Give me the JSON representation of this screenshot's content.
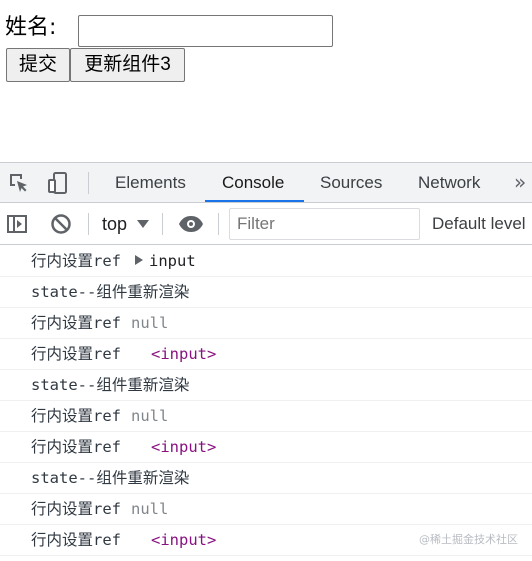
{
  "page": {
    "name_label": "姓名:",
    "name_value": "",
    "submit_label": "提交",
    "update_label": "更新组件3"
  },
  "devtools": {
    "tabs": [
      "Elements",
      "Console",
      "Sources",
      "Network"
    ],
    "more_label": "»",
    "context": "top",
    "filter_placeholder": "Filter",
    "levels_label": "Default level",
    "icons": [
      "inspect-element-icon",
      "device-toolbar-icon",
      "sidebar-toggle-icon",
      "clear-console-icon",
      "eye-icon",
      "dropdown-arrow-icon",
      "expand-arrow-icon"
    ],
    "colors": {
      "accent": "#1a73e8",
      "tag": "#881280",
      "null": "#80868b"
    }
  },
  "console": {
    "messages": [
      {
        "prefix": "行内设置ref",
        "object": "input"
      },
      {
        "prefix": "state--组件重新渲染"
      },
      {
        "prefix": "行内设置ref",
        "null": "null"
      },
      {
        "prefix": "行内设置ref",
        "tag": "<input>"
      },
      {
        "prefix": "state--组件重新渲染"
      },
      {
        "prefix": "行内设置ref",
        "null": "null"
      },
      {
        "prefix": "行内设置ref",
        "tag": "<input>"
      },
      {
        "prefix": "state--组件重新渲染"
      },
      {
        "prefix": "行内设置ref",
        "null": "null"
      },
      {
        "prefix": "行内设置ref",
        "tag": "<input>"
      }
    ]
  },
  "watermark": "@稀土掘金技术社区"
}
